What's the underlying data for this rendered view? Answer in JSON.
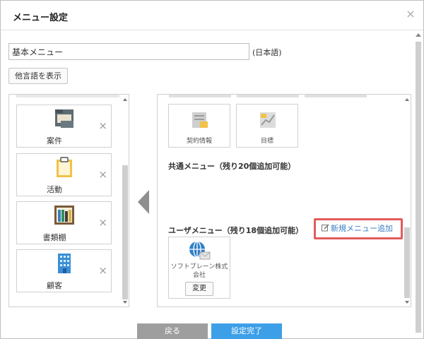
{
  "dialog": {
    "title": "メニュー設定",
    "close_icon": "×"
  },
  "menu_name": {
    "value": "基本メニュー",
    "language": "(日本語)"
  },
  "other_language_button": "他言語を表示",
  "available_menus": [
    {
      "label": "案件",
      "icon": "folder-icon"
    },
    {
      "label": "活動",
      "icon": "clipboard-icon"
    },
    {
      "label": "書類棚",
      "icon": "bookshelf-icon"
    },
    {
      "label": "顧客",
      "icon": "building-icon"
    }
  ],
  "remove_icon": "×",
  "selected_menus": [
    {
      "label": "契約情報",
      "icon": "contract-icon"
    },
    {
      "label": "目標",
      "icon": "target-icon"
    }
  ],
  "common_menu_title": "共通メニュー（残り20個追加可能）",
  "user_menu_title": "ユーザメニュー（残り18個追加可能）",
  "add_new_menu_link": "新規メニュー追加",
  "user_menu_tile": {
    "label": "ソフトブレーン株式会社",
    "icon": "globe-mail-icon",
    "change_button": "変更"
  },
  "footer": {
    "back_button": "戻る",
    "done_button": "設定完了"
  },
  "colors": {
    "highlight_border": "#e35b5b",
    "link": "#3b7fc4",
    "primary_button": "#3d9fe8",
    "secondary_button": "#9e9e9e"
  }
}
